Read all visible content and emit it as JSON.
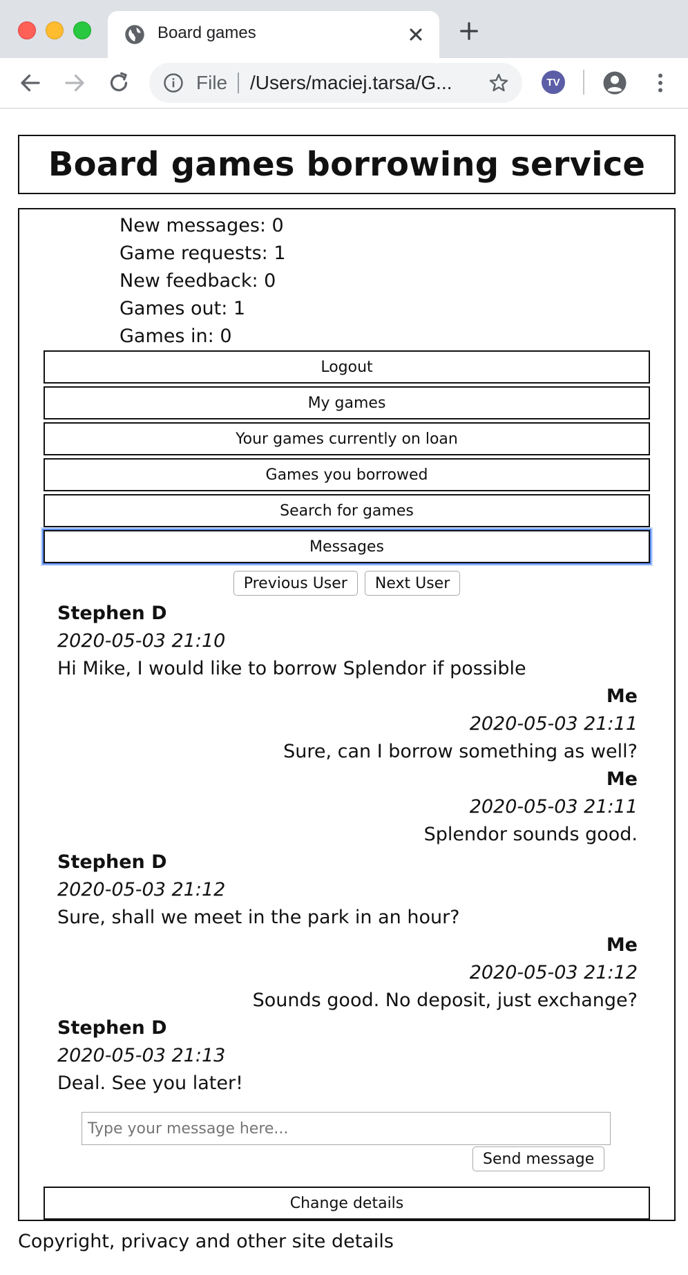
{
  "browser": {
    "tab_title": "Board games",
    "url_scheme": "File",
    "url": "/Users/maciej.tarsa/G...",
    "extension_badge": "TV"
  },
  "page": {
    "title": "Board games borrowing service",
    "stats": [
      "New messages: 0",
      "Game requests: 1",
      "New feedback: 0",
      "Games out: 1",
      "Games in: 0"
    ],
    "nav_buttons": [
      "Logout",
      "My games",
      "Your games currently on loan",
      "Games you borrowed",
      "Search for games",
      "Messages"
    ],
    "focused_button": "Messages",
    "pager": {
      "previous": "Previous User",
      "next": "Next User"
    },
    "messages": [
      {
        "author": "Stephen D",
        "time": "2020-05-03 21:10",
        "text": "Hi Mike, I would like to borrow Splendor if possible",
        "mine": false
      },
      {
        "author": "Me",
        "time": "2020-05-03 21:11",
        "text": "Sure, can I borrow something as well?",
        "mine": true
      },
      {
        "author": "Me",
        "time": "2020-05-03 21:11",
        "text": "Splendor sounds good.",
        "mine": true
      },
      {
        "author": "Stephen D",
        "time": "2020-05-03 21:12",
        "text": "Sure, shall we meet in the park in an hour?",
        "mine": false
      },
      {
        "author": "Me",
        "time": "2020-05-03 21:12",
        "text": "Sounds good. No deposit, just exchange?",
        "mine": true
      },
      {
        "author": "Stephen D",
        "time": "2020-05-03 21:13",
        "text": "Deal. See you later!",
        "mine": false
      }
    ],
    "composer": {
      "placeholder": "Type your message here...",
      "value": "",
      "send_label": "Send message"
    },
    "change_details": "Change details",
    "footer": "Copyright, privacy and other site details"
  },
  "colors": {
    "focus_ring": "#5b8ff2",
    "tabstrip": "#dee1e6",
    "omnibox": "#f1f3f4"
  }
}
